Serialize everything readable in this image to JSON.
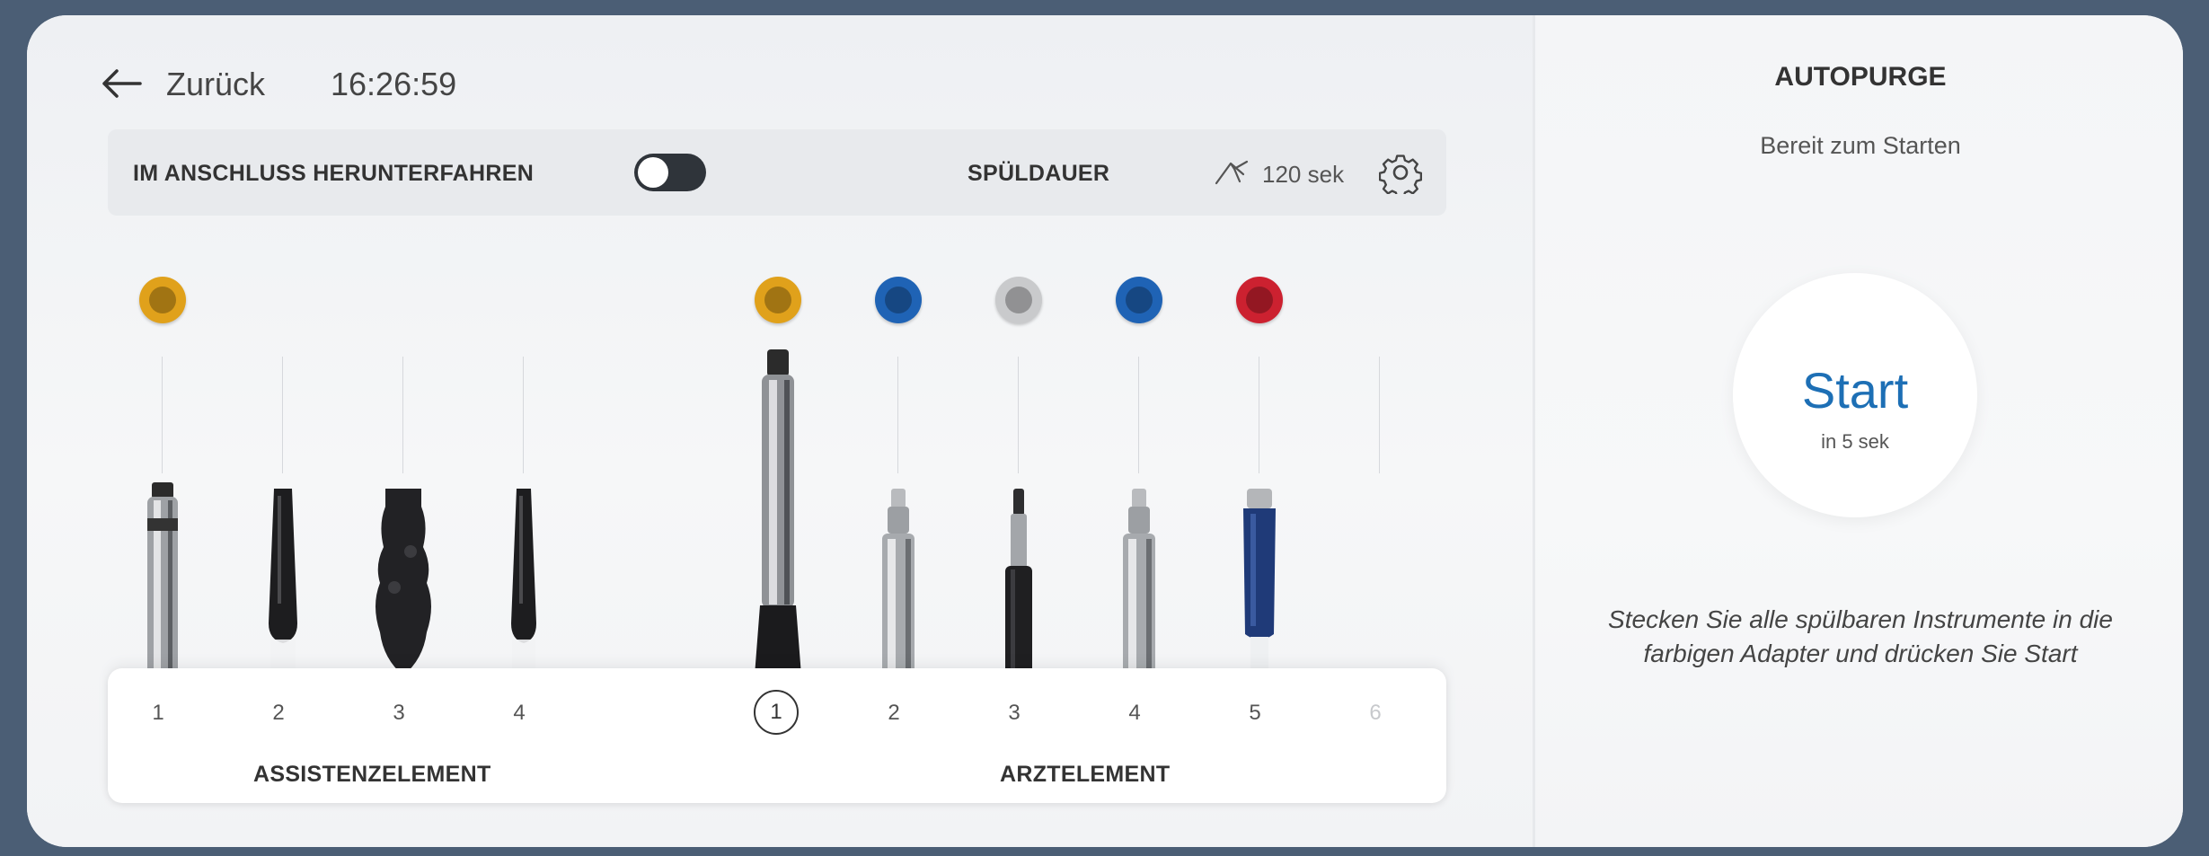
{
  "header": {
    "back_label": "Zurück",
    "time": "16:26:59"
  },
  "settings": {
    "shutdown_label": "IM ANSCHLUSS HERUNTERFAHREN",
    "shutdown_enabled": false,
    "duration_label": "SPÜLDAUER",
    "duration_value": "120 sek"
  },
  "assistant": {
    "label": "ASSISTENZELEMENT",
    "slots": [
      {
        "number": "1",
        "color": "#e0a11b",
        "instrument": "chrome"
      },
      {
        "number": "2",
        "color": null,
        "instrument": "black-tube"
      },
      {
        "number": "3",
        "color": null,
        "instrument": "black-bulky"
      },
      {
        "number": "4",
        "color": null,
        "instrument": "black-tube"
      }
    ]
  },
  "doctor": {
    "label": "ARZTELEMENT",
    "slots": [
      {
        "number": "1",
        "color": "#e0a11b",
        "instrument": "chrome-long",
        "selected": true
      },
      {
        "number": "2",
        "color": "#1f63b5",
        "instrument": "chrome-motor"
      },
      {
        "number": "3",
        "color": "#c9cacc",
        "instrument": "black-motor"
      },
      {
        "number": "4",
        "color": "#1f63b5",
        "instrument": "chrome-motor"
      },
      {
        "number": "5",
        "color": "#cc2130",
        "instrument": "blue-sleeve"
      },
      {
        "number": "6",
        "color": null,
        "instrument": null,
        "disabled": true
      }
    ]
  },
  "panel": {
    "title": "AUTOPURGE",
    "status": "Bereit zum Starten",
    "start_label": "Start",
    "countdown": "in 5 sek",
    "instruction": "Stecken Sie alle spülbaren Instrumente in die farbigen Adapter und drücken Sie Start"
  },
  "icons": {
    "back": "arrow-left-icon",
    "duration": "spray-icon",
    "settings": "gear-icon"
  }
}
